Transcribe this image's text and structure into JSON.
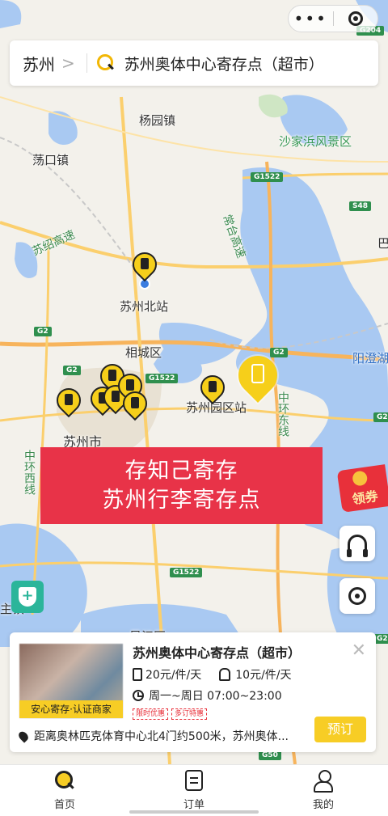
{
  "capsule": {
    "more": "•••",
    "close": ""
  },
  "search": {
    "city": "苏州",
    "chevron": ">",
    "query": "苏州奥体中心寄存点（超市）"
  },
  "map": {
    "labels": [
      "杨园镇",
      "沙家浜风景区",
      "荡口镇",
      "苏绍高速",
      "常台高速",
      "苏州北站",
      "相城区",
      "阳澄湖",
      "苏州园区站",
      "中环东线",
      "苏州市",
      "中环西线",
      "吴江区"
    ],
    "highways": [
      "G204",
      "G1522",
      "S48",
      "G2",
      "G2",
      "G2",
      "G1522",
      "G2",
      "G1522",
      "G2",
      "G50"
    ],
    "edge": [
      "巴",
      "主镇"
    ]
  },
  "banner": {
    "line1": "存知己寄存",
    "line2": "苏州行李寄存点"
  },
  "coupon": {
    "label": "领券"
  },
  "store": {
    "title": "苏州奥体中心寄存点（超市）",
    "price_large": "20元/件/天",
    "price_small": "10元/件/天",
    "hours": "周一~周日 07:00~23:00",
    "tags": [
      "限时优惠",
      "多订特惠"
    ],
    "badge": "安心寄存·认证商家",
    "address": "距离奥林匹克体育中心北4门约500米，苏州奥体...",
    "book": "预订"
  },
  "tabs": [
    {
      "label": "首页"
    },
    {
      "label": "订单"
    },
    {
      "label": "我的"
    }
  ],
  "colors": {
    "accent": "#f7cd25",
    "banner": "#e83348",
    "lake": "#a9c9f2"
  }
}
